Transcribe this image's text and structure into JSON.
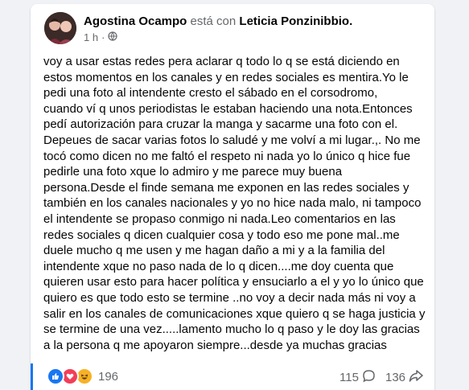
{
  "post": {
    "author": "Agostina Ocampo",
    "with_text": "está con",
    "tagged": "Leticia Ponzinibbio.",
    "time": "1 h",
    "separator": "·",
    "privacy_icon": "public-globe-icon",
    "body": "voy a usar estas redes pera aclarar q todo lo q se está diciendo en\nestos momentos en los canales y en redes sociales es mentira.Yo le\npedi una foto al intendente cresto el sábado en el corsodromo,\ncuando ví q unos periodistas le estaban haciendo una nota.Entonces\npedí autorización para cruzar la manga y sacarme una foto con el.\nDepeues de sacar varias fotos lo saludé y me volví a mi lugar.,. No me\ntocó como dicen no me faltó el respeto ni nada yo lo único q hice fue\npedirle una foto xque lo admiro y me parece muy buena\npersona.Desde el finde semana me exponen en las redes sociales y\ntambién en los canales nacionales y yo no hice nada malo, ni tampoco\nel intendente se propaso  conmigo  ni nada.Leo comentarios en las\nredes sociales q dicen cualquier cosa y todo eso me pone mal..me\nduele mucho q me usen y me hagan daño a mi y a la familia del\nintendente xque no paso nada de lo q dicen....me doy cuenta que\nquieren usar esto para hacer política y ensuciarlo a el y yo lo único que\nquiero es que todo esto se termine ..no voy a decir nada más ni voy a\nsalir en los canales de comunicaciones xque quiero q se haga justicia y\nse termine de una vez.....lamento mucho lo q paso y le doy las gracias\na la persona q me apoyaron siempre...desde ya muchas gracias"
  },
  "footer": {
    "reaction_icons": [
      "like-icon",
      "love-icon",
      "haha-icon"
    ],
    "reaction_count": "196",
    "comment_count": "115",
    "comment_icon": "comment-icon",
    "share_count": "136",
    "share_icon": "share-icon"
  },
  "colors": {
    "like": "#1877f2",
    "love": "#f33e58",
    "haha": "#f7b125",
    "secondary_text": "#65676b"
  }
}
